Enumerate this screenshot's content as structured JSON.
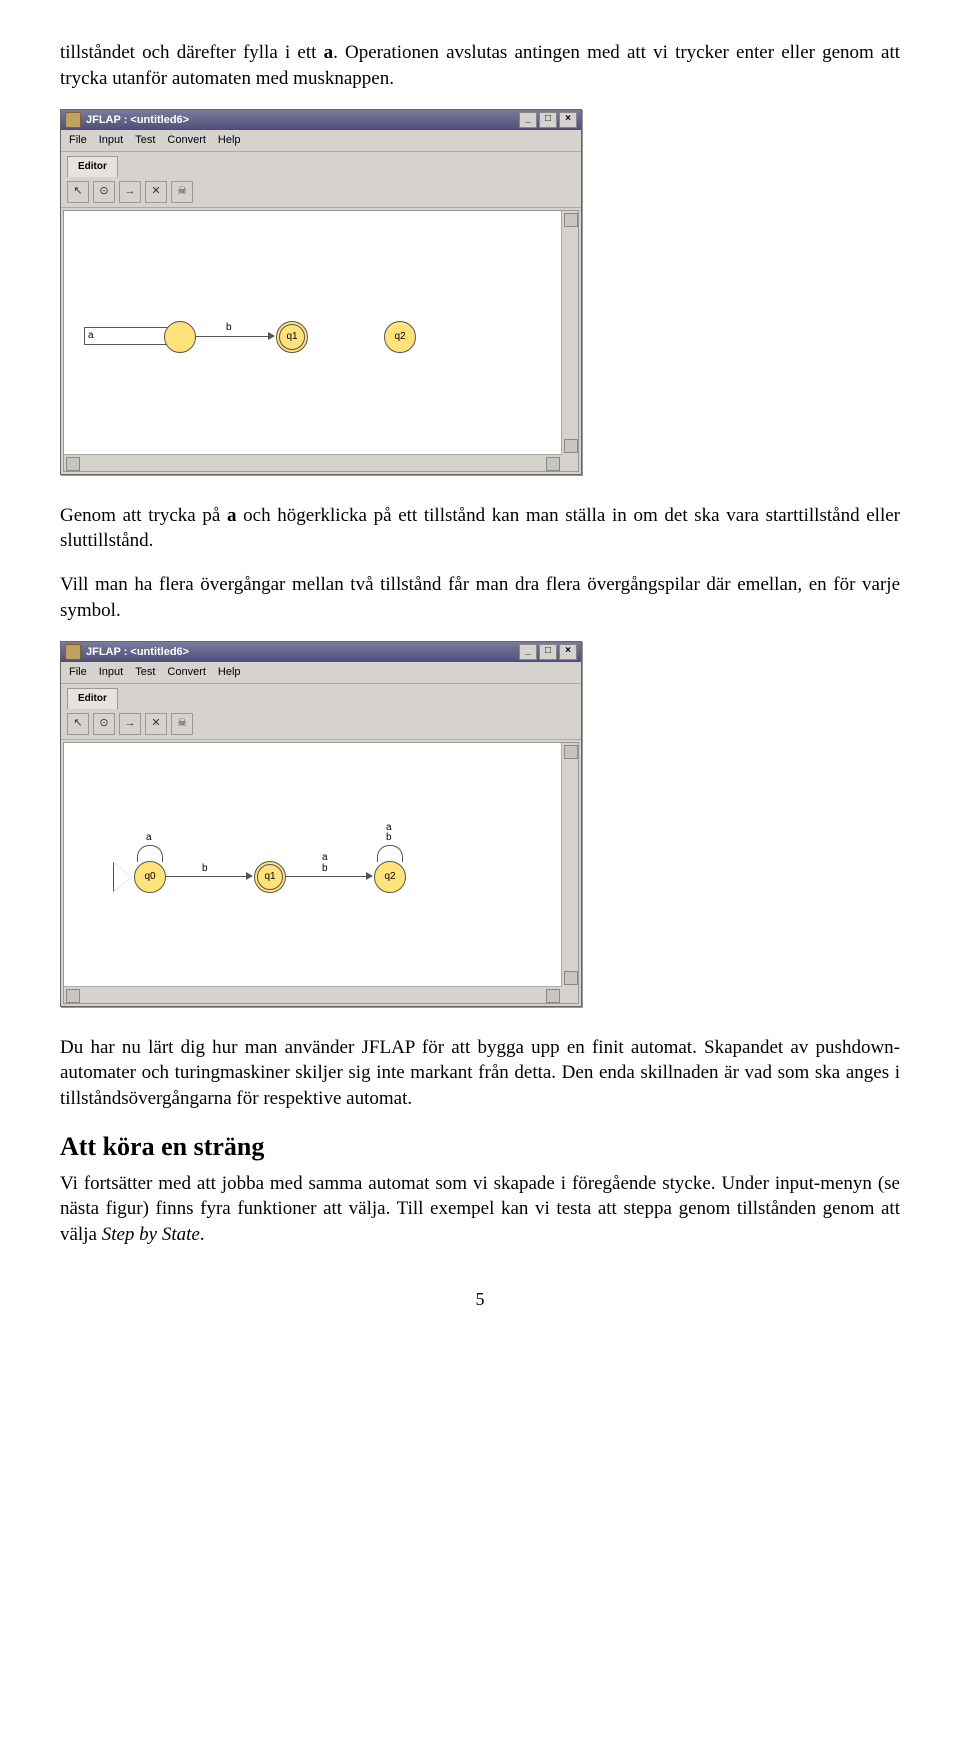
{
  "paragraphs": {
    "p1_pre": "tillståndet och därefter fylla i ett ",
    "p1_bold": "a",
    "p1_post": ". Operationen avslutas antingen med att vi trycker enter eller genom att trycka utanför automaten med musknappen.",
    "p2_pre": "Genom att trycka på ",
    "p2_bold": "a",
    "p2_post": " och högerklicka på ett tillstånd kan man ställa in om det ska vara starttillstånd eller sluttillstånd.",
    "p3": "Vill man ha flera övergångar mellan två tillstånd får man dra flera övergångspilar där emellan, en för varje symbol.",
    "p4": "Du har nu lärt dig hur man använder JFLAP för att bygga upp en finit automat. Skapandet av pushdown-automater och turingmaskiner skiljer sig inte markant från detta. Den enda skillnaden är vad som ska anges i tillståndsövergångarna för respektive automat.",
    "p5_pre": "Vi fortsätter med att jobba med samma automat som vi skapade i föregående stycke. Under input-menyn (se nästa figur) finns fyra funktioner att välja. Till exempel kan vi testa att steppa genom tillstånden genom att välja ",
    "p5_italic": "Step by State",
    "p5_post": "."
  },
  "heading": "Att köra en sträng",
  "jflap": {
    "title": "JFLAP : <untitled6>",
    "menu": [
      "File",
      "Input",
      "Test",
      "Convert",
      "Help"
    ],
    "tab": "Editor",
    "toolbar_icons": [
      "↖",
      "⊙",
      "→",
      "✕",
      "☠"
    ],
    "states": {
      "q0": "q0",
      "q1": "q1",
      "q2": "q2"
    },
    "labels": {
      "a": "a",
      "b": "b"
    },
    "input_value": "a"
  },
  "page_number": "5"
}
